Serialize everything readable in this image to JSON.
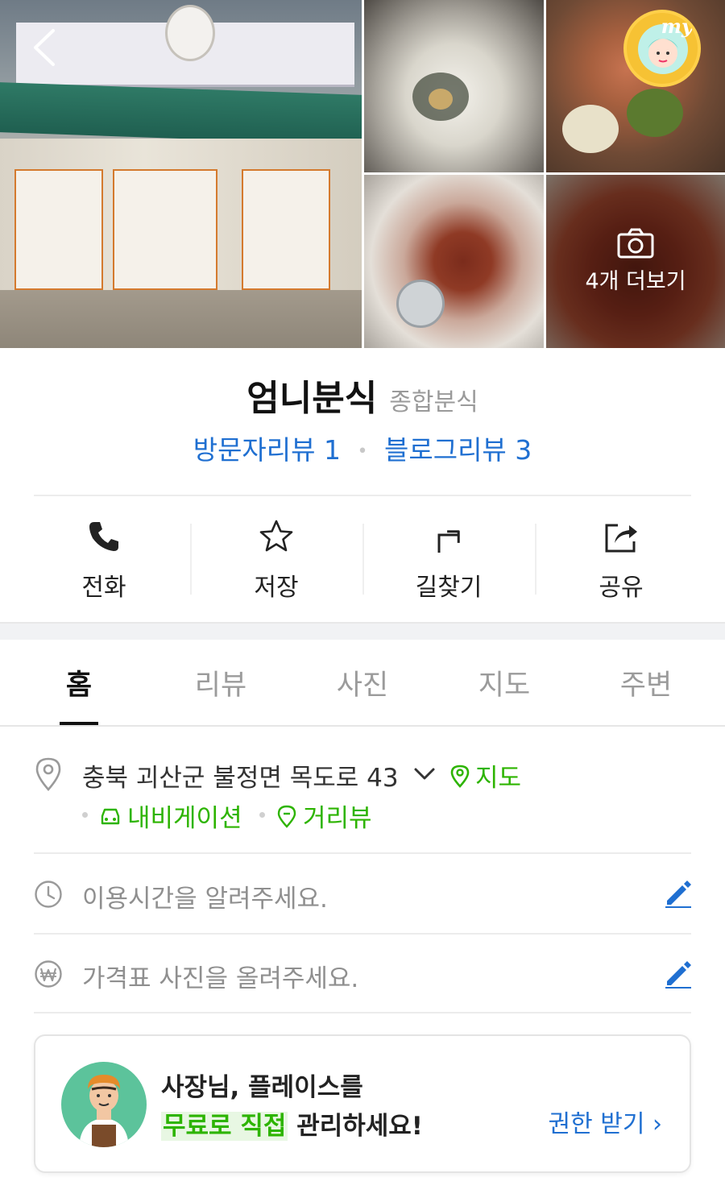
{
  "photos": {
    "more_label": "4개 더보기"
  },
  "header": {
    "my_label": "my"
  },
  "place": {
    "name": "엄니분식",
    "category": "종합분식",
    "visitor_review": "방문자리뷰 1",
    "blog_review": "블로그리뷰 3"
  },
  "actions": [
    {
      "label": "전화",
      "icon": "phone-icon"
    },
    {
      "label": "저장",
      "icon": "star-icon"
    },
    {
      "label": "길찾기",
      "icon": "directions-icon"
    },
    {
      "label": "공유",
      "icon": "share-icon"
    }
  ],
  "tabs": [
    {
      "label": "홈",
      "active": true
    },
    {
      "label": "리뷰",
      "active": false
    },
    {
      "label": "사진",
      "active": false
    },
    {
      "label": "지도",
      "active": false
    },
    {
      "label": "주변",
      "active": false
    }
  ],
  "address": {
    "text": "충북 괴산군 불정면 목도로 43",
    "map_link": "지도",
    "navigation_link": "내비게이션",
    "roadview_link": "거리뷰"
  },
  "hours": {
    "prompt": "이용시간을 알려주세요."
  },
  "price": {
    "prompt": "가격표 사진을 올려주세요."
  },
  "owner_card": {
    "line1": "사장님, 플레이스를",
    "line2_highlight": "무료로 직접",
    "line2_rest": " 관리하세요!",
    "cta": "권한 받기 ›"
  },
  "colors": {
    "link_blue": "#1f6fd1",
    "accent_green": "#2db400",
    "text_dark": "#222222",
    "text_muted": "#8f8f8f"
  }
}
